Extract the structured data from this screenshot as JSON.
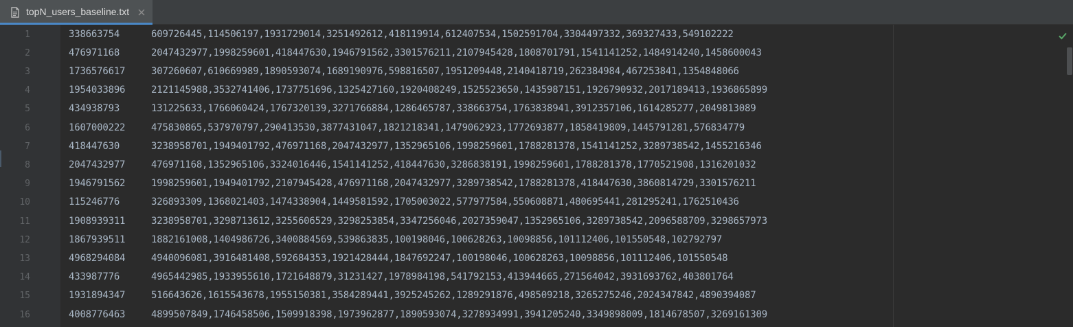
{
  "tab": {
    "title": "topN_users_baseline.txt"
  },
  "icons": {
    "file": "file-text-icon",
    "close": "close-icon",
    "status": "check-icon"
  },
  "colors": {
    "background": "#2b2b2b",
    "text": "#a9b7c6",
    "line_numbers": "#606366",
    "tab_accent": "#4a88c7",
    "check": "#59a869"
  },
  "lines": [
    {
      "num": "1",
      "uid": "338663754",
      "list": "609726445,114506197,1931729014,3251492612,418119914,612407534,1502591704,3304497332,369327433,549102222"
    },
    {
      "num": "2",
      "uid": "476971168",
      "list": "2047432977,1998259601,418447630,1946791562,3301576211,2107945428,1808701791,1541141252,1484914240,1458600043"
    },
    {
      "num": "3",
      "uid": "1736576617",
      "list": "307260607,610669989,1890593074,1689190976,598816507,1951209448,2140418719,262384984,467253841,1354848066"
    },
    {
      "num": "4",
      "uid": "1954033896",
      "list": "2121145988,3532741406,1737751696,1325427160,1920408249,1525523650,1435987151,1926790932,2017189413,1936865899"
    },
    {
      "num": "5",
      "uid": "434938793",
      "list": "131225633,1766060424,1767320139,3271766884,1286465787,338663754,1763838941,3912357106,1614285277,2049813089"
    },
    {
      "num": "6",
      "uid": "1607000222",
      "list": "475830865,537970797,290413530,3877431047,1821218341,1479062923,1772693877,1858419809,1445791281,576834779"
    },
    {
      "num": "7",
      "uid": "418447630",
      "list": "3238958701,1949401792,476971168,2047432977,1352965106,1998259601,1788281378,1541141252,3289738542,1455216346"
    },
    {
      "num": "8",
      "uid": "2047432977",
      "list": "476971168,1352965106,3324016446,1541141252,418447630,3286838191,1998259601,1788281378,1770521908,1316201032"
    },
    {
      "num": "9",
      "uid": "1946791562",
      "list": "1998259601,1949401792,2107945428,476971168,2047432977,3289738542,1788281378,418447630,3860814729,3301576211"
    },
    {
      "num": "10",
      "uid": "115246776",
      "list": "326893309,1368021403,1474338904,1449581592,1705003022,577977584,550608871,480695441,281295241,1762510436"
    },
    {
      "num": "11",
      "uid": "1908939311",
      "list": "3238958701,3298713612,3255606529,3298253854,3347256046,2027359047,1352965106,3289738542,2096588709,3298657973"
    },
    {
      "num": "12",
      "uid": "1867939511",
      "list": "1882161008,1404986726,3400884569,539863835,100198046,100628263,10098856,101112406,101550548,102792797"
    },
    {
      "num": "13",
      "uid": "4968294084",
      "list": "4940096081,3916481408,592684353,1921428444,1847692247,100198046,100628263,10098856,101112406,101550548"
    },
    {
      "num": "14",
      "uid": "433987776",
      "list": "4965442985,1933955610,1721648879,31231427,1978984198,541792153,413944665,271564042,3931693762,403801764"
    },
    {
      "num": "15",
      "uid": "1931894347",
      "list": "516643626,1615543678,1955150381,3584289441,3925245262,1289291876,498509218,3265275246,2024347842,4890394087"
    },
    {
      "num": "16",
      "uid": "4008776463",
      "list": "4899507849,1746458506,1509918398,1973962877,1890593074,3278934991,3941205240,3349898009,1814678507,3269161309"
    }
  ]
}
